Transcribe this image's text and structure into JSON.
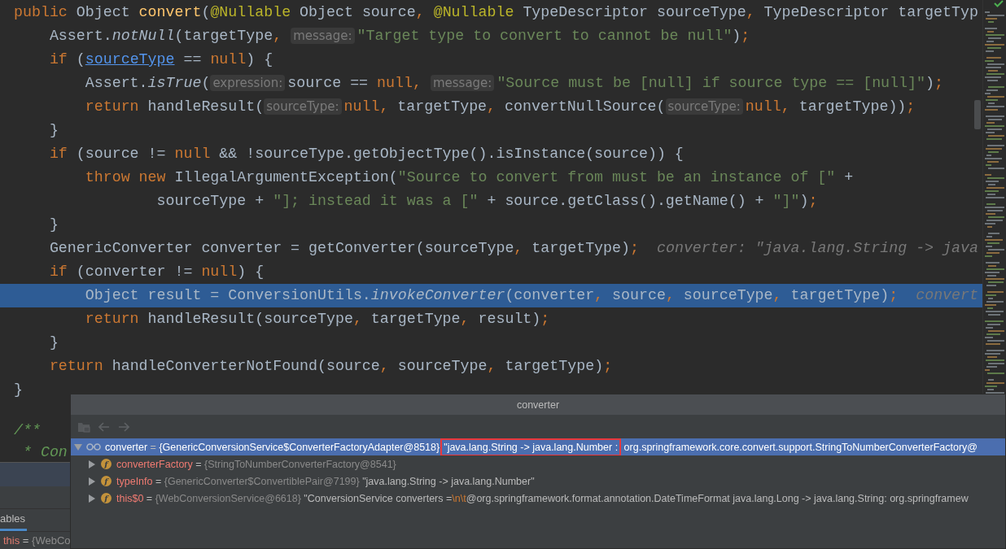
{
  "editor": {
    "lines": [
      {
        "selected": false,
        "tokens": [
          {
            "kind": "keyword",
            "text": "public"
          },
          {
            "kind": "plain",
            "text": " Object "
          },
          {
            "kind": "declaration",
            "text": "convert"
          },
          {
            "kind": "plain",
            "text": "("
          },
          {
            "kind": "annotation",
            "text": "@Nullable"
          },
          {
            "kind": "plain",
            "text": " Object source"
          },
          {
            "kind": "punct",
            "text": ", "
          },
          {
            "kind": "annotation",
            "text": "@Nullable"
          },
          {
            "kind": "plain",
            "text": " TypeDescriptor sourceType"
          },
          {
            "kind": "punct",
            "text": ","
          },
          {
            "kind": "plain",
            "text": " TypeDescriptor targetTyp"
          }
        ]
      },
      {
        "selected": false,
        "tokens": [
          {
            "kind": "plain",
            "text": "    Assert."
          },
          {
            "kind": "italic",
            "text": "notNull"
          },
          {
            "kind": "plain",
            "text": "(targetType"
          },
          {
            "kind": "punct",
            "text": ", "
          },
          {
            "kind": "hint",
            "text": "message:"
          },
          {
            "kind": "string",
            "text": "\"Target type to convert to cannot be null\""
          },
          {
            "kind": "plain",
            "text": ")"
          },
          {
            "kind": "punct",
            "text": ";"
          }
        ]
      },
      {
        "selected": false,
        "tokens": [
          {
            "kind": "keyword",
            "text": "    if"
          },
          {
            "kind": "plain",
            "text": " ("
          },
          {
            "kind": "link",
            "text": "sourceType"
          },
          {
            "kind": "plain",
            "text": " == "
          },
          {
            "kind": "keyword",
            "text": "null"
          },
          {
            "kind": "plain",
            "text": ") {"
          }
        ]
      },
      {
        "selected": false,
        "tokens": [
          {
            "kind": "plain",
            "text": "        Assert."
          },
          {
            "kind": "italic",
            "text": "isTrue"
          },
          {
            "kind": "plain",
            "text": "("
          },
          {
            "kind": "hint",
            "text": "expression:"
          },
          {
            "kind": "plain",
            "text": "source == "
          },
          {
            "kind": "keyword",
            "text": "null"
          },
          {
            "kind": "punct",
            "text": ", "
          },
          {
            "kind": "hint",
            "text": "message:"
          },
          {
            "kind": "string",
            "text": "\"Source must be [null] if source type == [null]\""
          },
          {
            "kind": "plain",
            "text": ")"
          },
          {
            "kind": "punct",
            "text": ";"
          }
        ]
      },
      {
        "selected": false,
        "tokens": [
          {
            "kind": "keyword",
            "text": "        return"
          },
          {
            "kind": "plain",
            "text": " handleResult("
          },
          {
            "kind": "hint",
            "text": "sourceType:"
          },
          {
            "kind": "keyword",
            "text": "null"
          },
          {
            "kind": "punct",
            "text": ","
          },
          {
            "kind": "plain",
            "text": " targetType"
          },
          {
            "kind": "punct",
            "text": ","
          },
          {
            "kind": "plain",
            "text": " convertNullSource("
          },
          {
            "kind": "hint",
            "text": "sourceType:"
          },
          {
            "kind": "keyword",
            "text": "null"
          },
          {
            "kind": "punct",
            "text": ","
          },
          {
            "kind": "plain",
            "text": " targetType))"
          },
          {
            "kind": "punct",
            "text": ";"
          }
        ]
      },
      {
        "selected": false,
        "tokens": [
          {
            "kind": "plain",
            "text": "    }"
          }
        ]
      },
      {
        "selected": false,
        "tokens": [
          {
            "kind": "keyword",
            "text": "    if"
          },
          {
            "kind": "plain",
            "text": " (source != "
          },
          {
            "kind": "keyword",
            "text": "null"
          },
          {
            "kind": "plain",
            "text": " && !sourceType.getObjectType().isInstance(source)) {"
          }
        ]
      },
      {
        "selected": false,
        "tokens": [
          {
            "kind": "keyword",
            "text": "        throw new"
          },
          {
            "kind": "plain",
            "text": " IllegalArgumentException("
          },
          {
            "kind": "string",
            "text": "\"Source to convert from must be an instance of [\""
          },
          {
            "kind": "plain",
            "text": " +"
          }
        ]
      },
      {
        "selected": false,
        "tokens": [
          {
            "kind": "plain",
            "text": "                sourceType + "
          },
          {
            "kind": "string",
            "text": "\"]; instead it was a [\""
          },
          {
            "kind": "plain",
            "text": " + source.getClass().getName() + "
          },
          {
            "kind": "string",
            "text": "\"]\""
          },
          {
            "kind": "plain",
            "text": ")"
          },
          {
            "kind": "punct",
            "text": ";"
          }
        ]
      },
      {
        "selected": false,
        "tokens": [
          {
            "kind": "plain",
            "text": "    }"
          }
        ]
      },
      {
        "selected": false,
        "tokens": [
          {
            "kind": "plain",
            "text": "    GenericConverter converter = getConverter(sourceType"
          },
          {
            "kind": "punct",
            "text": ","
          },
          {
            "kind": "plain",
            "text": " targetType)"
          },
          {
            "kind": "punct",
            "text": ";"
          },
          {
            "kind": "inline_value",
            "text": "converter: \"java.lang.String -> java"
          }
        ]
      },
      {
        "selected": false,
        "tokens": [
          {
            "kind": "keyword",
            "text": "    if"
          },
          {
            "kind": "plain",
            "text": " (converter != "
          },
          {
            "kind": "keyword",
            "text": "null"
          },
          {
            "kind": "plain",
            "text": ") {"
          }
        ]
      },
      {
        "selected": true,
        "tokens": [
          {
            "kind": "plain",
            "text": "        Object result = ConversionUtils."
          },
          {
            "kind": "italic",
            "text": "invokeConverter"
          },
          {
            "kind": "plain",
            "text": "(converter"
          },
          {
            "kind": "punct",
            "text": ","
          },
          {
            "kind": "plain",
            "text": " source"
          },
          {
            "kind": "punct",
            "text": ","
          },
          {
            "kind": "plain",
            "text": " sourceType"
          },
          {
            "kind": "punct",
            "text": ","
          },
          {
            "kind": "plain",
            "text": " targetType)"
          },
          {
            "kind": "punct",
            "text": ";"
          },
          {
            "kind": "inline_value",
            "text": "convert"
          }
        ]
      },
      {
        "selected": false,
        "tokens": [
          {
            "kind": "keyword",
            "text": "        return"
          },
          {
            "kind": "plain",
            "text": " handleResult(sourceType"
          },
          {
            "kind": "punct",
            "text": ","
          },
          {
            "kind": "plain",
            "text": " targetType"
          },
          {
            "kind": "punct",
            "text": ","
          },
          {
            "kind": "plain",
            "text": " result)"
          },
          {
            "kind": "punct",
            "text": ";"
          }
        ]
      },
      {
        "selected": false,
        "tokens": [
          {
            "kind": "plain",
            "text": "    }"
          }
        ]
      },
      {
        "selected": false,
        "tokens": [
          {
            "kind": "keyword",
            "text": "    return"
          },
          {
            "kind": "plain",
            "text": " handleConverterNotFound(source"
          },
          {
            "kind": "punct",
            "text": ","
          },
          {
            "kind": "plain",
            "text": " sourceType"
          },
          {
            "kind": "punct",
            "text": ","
          },
          {
            "kind": "plain",
            "text": " targetType)"
          },
          {
            "kind": "punct",
            "text": ";"
          }
        ]
      },
      {
        "selected": false,
        "tokens": [
          {
            "kind": "plain",
            "text": "}"
          }
        ]
      }
    ],
    "doc_comment": [
      "/**",
      " * Con"
    ]
  },
  "debug_panel": {
    "tab": {
      "label": "ables",
      "selected": true
    },
    "variables": [
      {
        "name": "this",
        "sign": "=",
        "value": "{WebCo"
      }
    ]
  },
  "popup": {
    "title": "converter",
    "tree": [
      {
        "kind": "watch",
        "expanded": true,
        "selected": true,
        "name": "converter",
        "sign": "=",
        "type": "{GenericConversionService$ConverterFactoryAdapter@8518}",
        "value": [
          {
            "kind": "text",
            "text": "\"java.lang.String -> java.lang.Number :",
            "boxed": true
          },
          {
            "kind": "text",
            "text": " org.springframework.core.convert.support.StringToNumberConverterFactory@",
            "boxed": false
          }
        ]
      },
      {
        "kind": "field",
        "badge": "f",
        "expanded": false,
        "selected": false,
        "name": "converterFactory",
        "sign": "=",
        "type": "{StringToNumberConverterFactory@8541}"
      },
      {
        "kind": "field",
        "badge": "f",
        "expanded": false,
        "selected": false,
        "name": "typeInfo",
        "sign": "=",
        "type": "{GenericConverter$ConvertiblePair@7199}",
        "value": [
          {
            "kind": "text",
            "text": "\"java.lang.String -> java.lang.Number\"",
            "boxed": false
          }
        ]
      },
      {
        "kind": "field",
        "badge": "f",
        "expanded": false,
        "selected": false,
        "name": "this$0",
        "sign": "=",
        "type": "{WebConversionService@6618}",
        "value": [
          {
            "kind": "text",
            "text": "\"ConversionService converters =",
            "boxed": false
          },
          {
            "kind": "escape",
            "text": "\\n\\t",
            "boxed": false
          },
          {
            "kind": "text",
            "text": "@org.springframework.format.annotation.DateTimeFormat java.lang.Long -> java.lang.String: org.springframew",
            "boxed": false
          }
        ]
      }
    ]
  }
}
